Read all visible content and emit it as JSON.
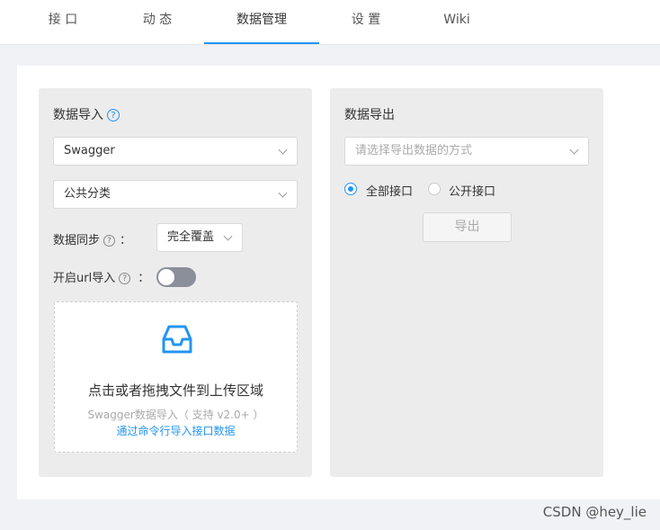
{
  "tabs": [
    {
      "label": "接 口"
    },
    {
      "label": "动 态"
    },
    {
      "label": "数据管理",
      "active": true
    },
    {
      "label": "设 置"
    },
    {
      "label": "Wiki"
    }
  ],
  "import_panel": {
    "title": "数据导入",
    "help_icon": "question-circle",
    "source_select": {
      "value": "Swagger"
    },
    "category_select": {
      "value": "公共分类"
    },
    "sync_label": "数据同步",
    "sync_colon": "：",
    "sync_select": {
      "value": "完全覆盖"
    },
    "url_import_label": "开启url导入",
    "url_import_colon": "：",
    "url_import_enabled": false,
    "dropzone": {
      "icon": "inbox-icon",
      "main_text": "点击或者拖拽文件到上传区域",
      "hint": "Swagger数据导入（ 支持 v2.0+ ）",
      "link": "通过命令行导入接口数据"
    }
  },
  "export_panel": {
    "title": "数据导出",
    "method_select": {
      "placeholder": "请选择导出数据的方式"
    },
    "radio_all": {
      "label": "全部接口",
      "checked": true
    },
    "radio_public": {
      "label": "公开接口",
      "checked": false
    },
    "export_button": "导出"
  },
  "watermark": "CSDN @hey_lie",
  "colors": {
    "accent": "#2395f1",
    "panel_bg": "#ececec",
    "page_bg": "#f0f2f5"
  }
}
